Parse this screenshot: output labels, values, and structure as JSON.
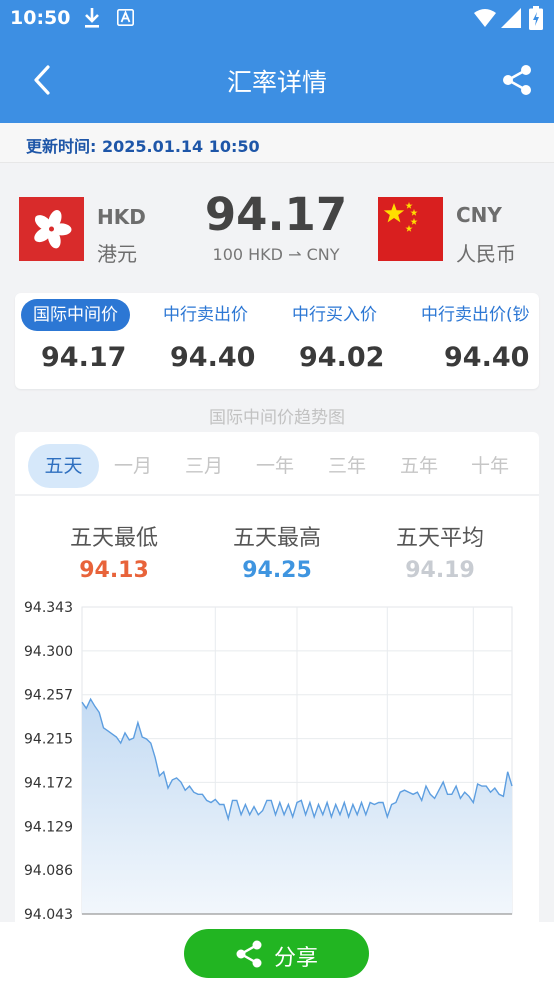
{
  "status_bar": {
    "time": "10:50"
  },
  "app_bar": {
    "title": "汇率详情"
  },
  "update": {
    "text": "更新时间: 2025.01.14 10:50"
  },
  "from_currency": {
    "code": "HKD",
    "name": "港元"
  },
  "to_currency": {
    "code": "CNY",
    "name": "人民币"
  },
  "rate": {
    "value": "94.17",
    "pair": "100 HKD ⇀ CNY"
  },
  "prices": [
    {
      "label": "国际中间价",
      "value": "94.17",
      "active": true
    },
    {
      "label": "中行卖出价",
      "value": "94.40",
      "active": false
    },
    {
      "label": "中行买入价",
      "value": "94.02",
      "active": false
    },
    {
      "label": "中行卖出价(钞",
      "value": "94.40",
      "active": false
    }
  ],
  "trend_title": "国际中间价趋势图",
  "tabs": [
    "五天",
    "一月",
    "三月",
    "一年",
    "三年",
    "五年",
    "十年"
  ],
  "active_tab": 0,
  "stats": [
    {
      "label": "五天最低",
      "value": "94.13",
      "color": "#e8633a"
    },
    {
      "label": "五天最高",
      "value": "94.25",
      "color": "#3f95e0"
    },
    {
      "label": "五天平均",
      "value": "94.19",
      "color": "#c8ccd2"
    }
  ],
  "chart_data": {
    "type": "area",
    "ylim": [
      94.043,
      94.343
    ],
    "yticks": [
      "94.343",
      "94.300",
      "94.257",
      "94.215",
      "94.172",
      "94.129",
      "94.086",
      "94.043"
    ],
    "x": [
      0,
      1,
      2,
      3,
      4,
      5,
      6,
      7,
      8,
      9,
      10,
      11,
      12,
      13,
      14,
      15,
      16,
      17,
      18,
      19,
      20,
      21,
      22,
      23,
      24,
      25,
      26,
      27,
      28,
      29,
      30,
      31,
      32,
      33,
      34,
      35,
      36,
      37,
      38,
      39,
      40,
      41,
      42,
      43,
      44,
      45,
      46,
      47,
      48,
      49,
      50,
      51,
      52,
      53,
      54,
      55,
      56,
      57,
      58,
      59,
      60,
      61,
      62,
      63,
      64,
      65,
      66,
      67,
      68,
      69,
      70,
      71,
      72,
      73,
      74,
      75,
      76,
      77,
      78,
      79,
      80,
      81,
      82,
      83,
      84,
      85,
      86,
      87,
      88,
      89,
      90,
      91,
      92,
      93,
      94,
      95,
      96,
      97,
      98,
      99,
      100
    ],
    "values": [
      94.25,
      94.244,
      94.253,
      94.246,
      94.24,
      94.225,
      94.222,
      94.219,
      94.216,
      94.21,
      94.22,
      94.213,
      94.215,
      94.23,
      94.216,
      94.214,
      94.21,
      94.196,
      94.178,
      94.182,
      94.166,
      94.174,
      94.176,
      94.172,
      94.164,
      94.168,
      94.162,
      94.16,
      94.16,
      94.154,
      94.152,
      94.155,
      94.15,
      94.15,
      94.136,
      94.154,
      94.154,
      94.14,
      94.15,
      94.14,
      94.148,
      94.14,
      94.144,
      94.154,
      94.154,
      94.14,
      94.152,
      94.14,
      94.15,
      94.138,
      94.152,
      94.154,
      94.14,
      94.152,
      94.138,
      94.15,
      94.14,
      94.152,
      94.138,
      94.15,
      94.14,
      94.152,
      94.138,
      94.15,
      94.14,
      94.152,
      94.14,
      94.152,
      94.15,
      94.152,
      94.152,
      94.138,
      94.15,
      94.152,
      94.162,
      94.164,
      94.162,
      94.16,
      94.162,
      94.154,
      94.168,
      94.16,
      94.156,
      94.164,
      94.172,
      94.16,
      94.16,
      94.168,
      94.156,
      94.162,
      94.158,
      94.152,
      94.17,
      94.168,
      94.168,
      94.162,
      94.166,
      94.16,
      94.158,
      94.182,
      94.168
    ],
    "grid": true,
    "line_color": "#5d9ee0"
  }
}
